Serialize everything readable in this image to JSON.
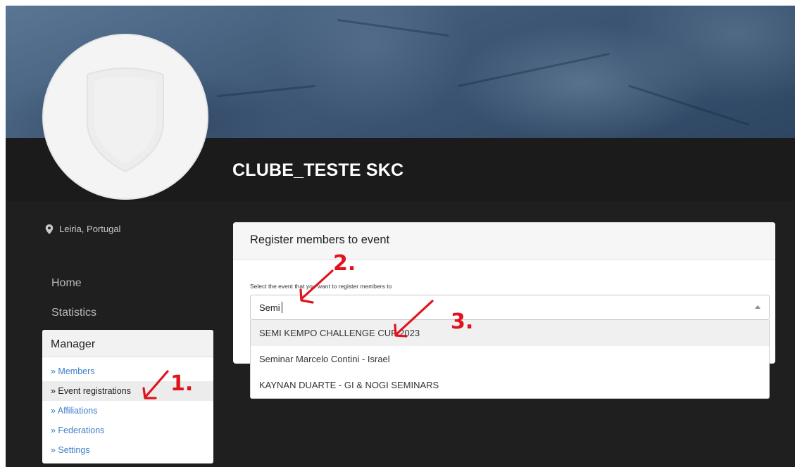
{
  "club": {
    "name": "CLUBE_TESTE SKC",
    "location": "Leiria, Portugal"
  },
  "nav": {
    "home": "Home",
    "statistics": "Statistics"
  },
  "manager": {
    "title": "Manager",
    "items": [
      {
        "label": "» Members"
      },
      {
        "label": "» Event registrations",
        "active": true
      },
      {
        "label": "» Affiliations"
      },
      {
        "label": "» Federations"
      },
      {
        "label": "» Settings"
      }
    ]
  },
  "register": {
    "title": "Register members to event",
    "field_label": "Select the event that you want to register members to",
    "search_value": "Semi",
    "options": [
      {
        "label": "SEMI KEMPO CHALLENGE CUP 2023",
        "highlighted": true
      },
      {
        "label": "Seminar Marcelo Contini - Israel"
      },
      {
        "label": "KAYNAN DUARTE - GI & NOGI SEMINARS"
      }
    ]
  },
  "annotations": {
    "step1": "1.",
    "step2": "2.",
    "step3": "3."
  },
  "colors": {
    "link": "#3d7fc6",
    "annotation": "#e0141e",
    "header_bg": "#1b1b1b",
    "page_bg": "#1f1f1f"
  },
  "icons": {
    "location": "map-pin-icon",
    "avatar": "shield-icon",
    "select": "caret-up-icon"
  }
}
